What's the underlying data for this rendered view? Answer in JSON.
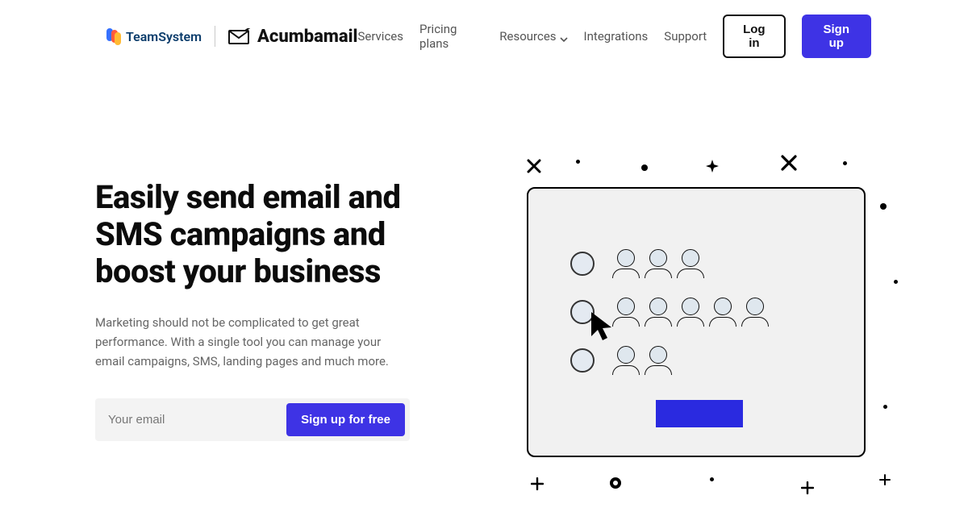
{
  "header": {
    "teamsystem": "TeamSystem",
    "acumbamail": "Acumbamail",
    "nav": {
      "services": "Services",
      "pricing": "Pricing plans",
      "resources": "Resources",
      "integrations": "Integrations",
      "support": "Support"
    },
    "login": "Log in",
    "signup": "Sign up"
  },
  "hero": {
    "title": "Easily send email and SMS campaigns and boost your business",
    "lead": "Marketing should not be complicated to get great performance. With a single tool you can manage your email campaigns, SMS, landing pages and much more.",
    "email_placeholder": "Your email",
    "cta": "Sign up for free"
  }
}
